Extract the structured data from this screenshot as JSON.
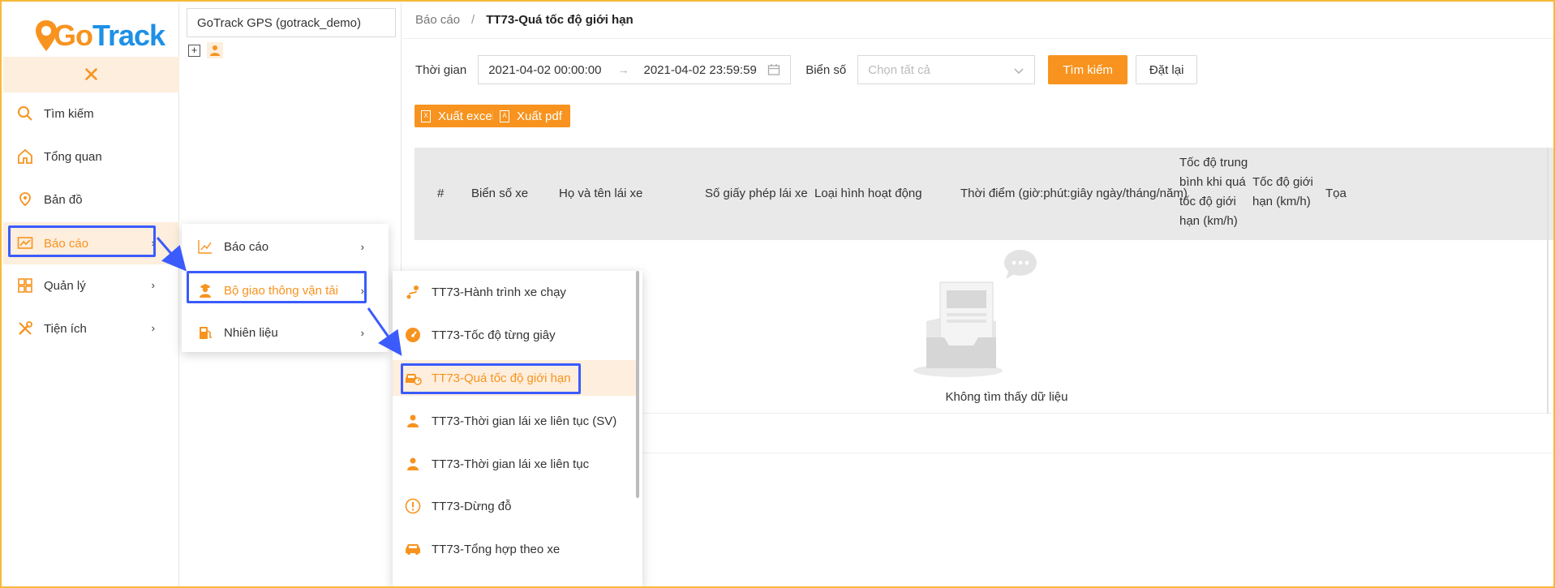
{
  "brand": {
    "logo_go": "Go",
    "logo_track": "Track"
  },
  "sidebar": {
    "collapse_icon": "close-icon",
    "items": [
      {
        "label": "Tìm kiếm",
        "icon": "search-icon"
      },
      {
        "label": "Tổng quan",
        "icon": "home-icon"
      },
      {
        "label": "Bản đồ",
        "icon": "map-icon"
      },
      {
        "label": "Báo cáo",
        "icon": "chart-icon",
        "active": true
      },
      {
        "label": "Quản lý",
        "icon": "grid-icon"
      },
      {
        "label": "Tiện ích",
        "icon": "tools-icon"
      }
    ]
  },
  "tree": {
    "selected": "GoTrack GPS (gotrack_demo)",
    "expand": "+"
  },
  "breadcrumb": {
    "root": "Báo cáo",
    "sep": "/",
    "current": "TT73-Quá tốc độ giới hạn"
  },
  "filters": {
    "time_label": "Thời gian",
    "from": "2021-04-02 00:00:00",
    "arrow": "→",
    "to": "2021-04-02 23:59:59",
    "plate_label": "Biển số",
    "plate_placeholder": "Chọn tất cả",
    "search_button": "Tìm kiếm",
    "reset_button": "Đặt lại"
  },
  "export": {
    "excel": "Xuất excel",
    "pdf": "Xuất pdf"
  },
  "table": {
    "columns": [
      "#",
      "Biển số xe",
      "Họ và tên lái xe",
      "Số giấy phép lái xe",
      "Loại hình hoạt động",
      "Thời điểm (giờ:phút:giây ngày/tháng/năm)",
      "Tốc độ trung bình khi quá tốc độ giới hạn (km/h)",
      "Tốc độ giới hạn (km/h)",
      "Tọa"
    ],
    "col7_lines": [
      "Tốc độ trung",
      "bình khi quá",
      "tốc độ giới",
      "hạn (km/h)"
    ],
    "col8_lines": [
      "Tốc độ giới",
      "hạn (km/h)"
    ],
    "empty_text": "Không tìm thấy dữ liệu"
  },
  "menu_level1": [
    {
      "label": "Báo cáo",
      "icon": "line-chart-icon"
    },
    {
      "label": "Bộ giao thông vận tải",
      "icon": "officer-icon",
      "active": true
    },
    {
      "label": "Nhiên liệu",
      "icon": "fuel-icon"
    }
  ],
  "menu_level2": [
    {
      "label": "TT73-Hành trình xe chạy",
      "icon": "route-icon"
    },
    {
      "label": "TT73-Tốc độ từng giây",
      "icon": "speedometer-icon"
    },
    {
      "label": "TT73-Quá tốc độ giới hạn",
      "icon": "car-speed-icon",
      "active": true
    },
    {
      "label": "TT73-Thời gian lái xe liên tục (SV)",
      "icon": "driver-icon"
    },
    {
      "label": "TT73-Thời gian lái xe liên tục",
      "icon": "driver-icon"
    },
    {
      "label": "TT73-Dừng đỗ",
      "icon": "warning-icon"
    },
    {
      "label": "TT73-Tổng hợp theo xe",
      "icon": "car-icon"
    }
  ],
  "colors": {
    "accent": "#f7931e",
    "brand_blue": "#1e90e6",
    "highlight": "#3b5bfd",
    "active_bg": "#fdeedd"
  }
}
